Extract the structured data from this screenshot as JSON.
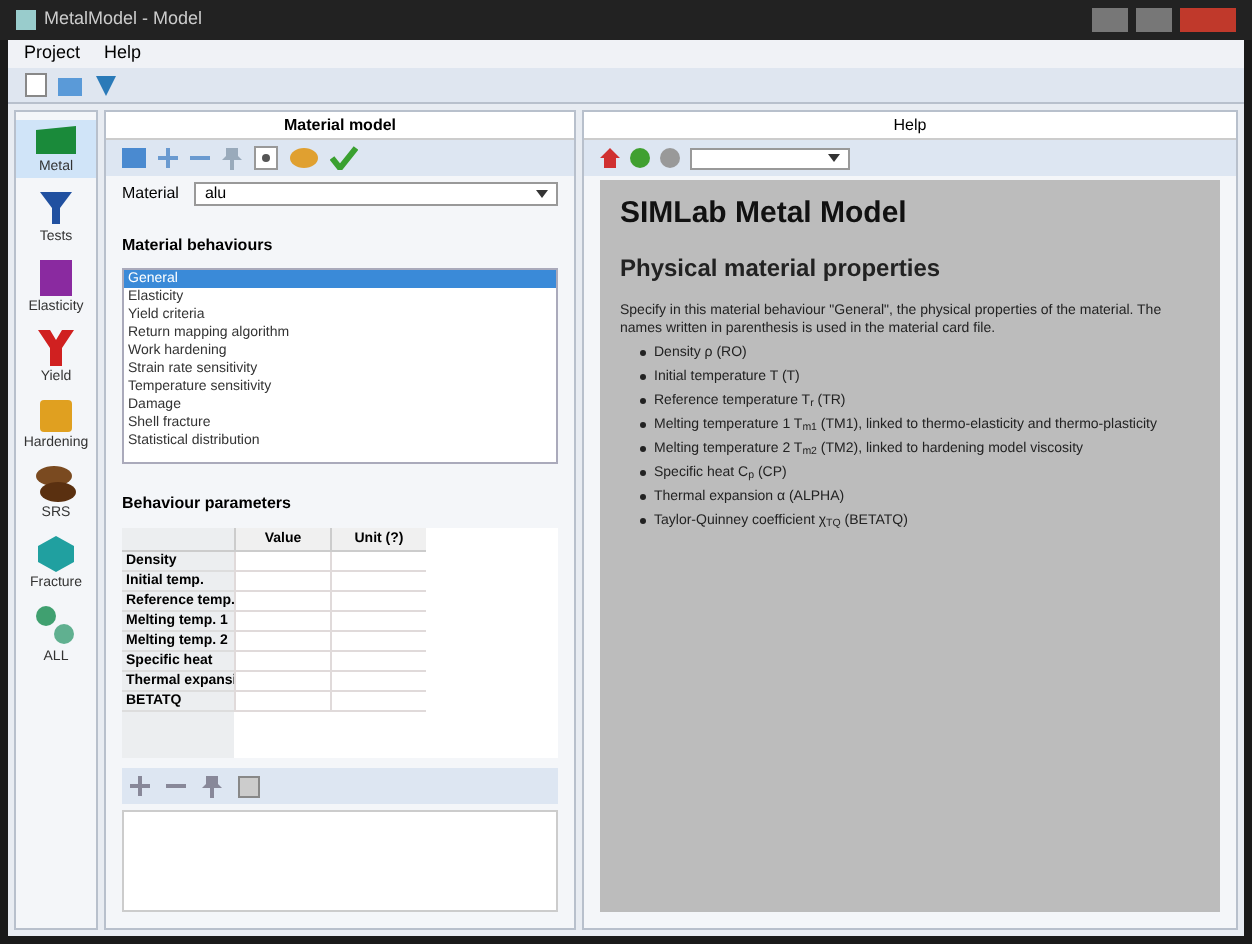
{
  "window": {
    "title": "MetalModel - Model"
  },
  "menu": [
    "Project",
    "Help"
  ],
  "sidebar": [
    {
      "label": "Metal",
      "kind": "metal",
      "selected": true
    },
    {
      "label": "Tests",
      "kind": "tests",
      "selected": false
    },
    {
      "label": "Elasticity",
      "kind": "elasticity",
      "selected": false
    },
    {
      "label": "Yield",
      "kind": "yield",
      "selected": false
    },
    {
      "label": "Hardening",
      "kind": "hardening",
      "selected": false
    },
    {
      "label": "SRS",
      "kind": "srs",
      "selected": false
    },
    {
      "label": "Fracture",
      "kind": "fracture",
      "selected": false
    },
    {
      "label": "ALL",
      "kind": "all",
      "selected": false
    }
  ],
  "material_panel": {
    "title": "Material model",
    "material_label": "Material",
    "material_value": "alu",
    "behaviours_title": "Material behaviours",
    "behaviours": [
      {
        "label": "General",
        "selected": true
      },
      {
        "label": "Elasticity",
        "selected": false
      },
      {
        "label": "Yield criteria",
        "selected": false
      },
      {
        "label": "Return mapping algorithm",
        "selected": false
      },
      {
        "label": "Work hardening",
        "selected": false
      },
      {
        "label": "Strain rate sensitivity",
        "selected": false
      },
      {
        "label": "Temperature sensitivity",
        "selected": false
      },
      {
        "label": "Damage",
        "selected": false
      },
      {
        "label": "Shell fracture",
        "selected": false
      },
      {
        "label": "Statistical distribution",
        "selected": false
      }
    ],
    "parameters_title": "Behaviour parameters",
    "columns": [
      "Value",
      "Unit (?)"
    ],
    "rows": [
      "Density",
      "Initial temp.",
      "Reference temp.",
      "Melting temp. 1",
      "Melting temp. 2",
      "Specific heat",
      "Thermal expansi",
      "BETATQ"
    ]
  },
  "help_panel": {
    "title": "Help",
    "heading": "SIMLab Metal Model",
    "subheading": "Physical material properties",
    "intro": "Specify in this material behaviour \"General\", the physical properties of the material. The names written in parenthesis is used in the material card file.",
    "bullets": [
      "Density ρ (RO)",
      "Initial temperature T (T)",
      "Reference temperature T$_{r}$ (TR)",
      "Melting temperature 1 T$_{m1}$ (TM1), linked to thermo-elasticity and thermo-plasticity",
      "Melting temperature 2 T$_{m2}$ (TM2), linked to hardening model viscosity",
      "Specific heat C$_{p}$ (CP)",
      "Thermal expansion α (ALPHA)",
      "Taylor-Quinney coefficient χ$_{TQ}$ (BETATQ)"
    ]
  }
}
